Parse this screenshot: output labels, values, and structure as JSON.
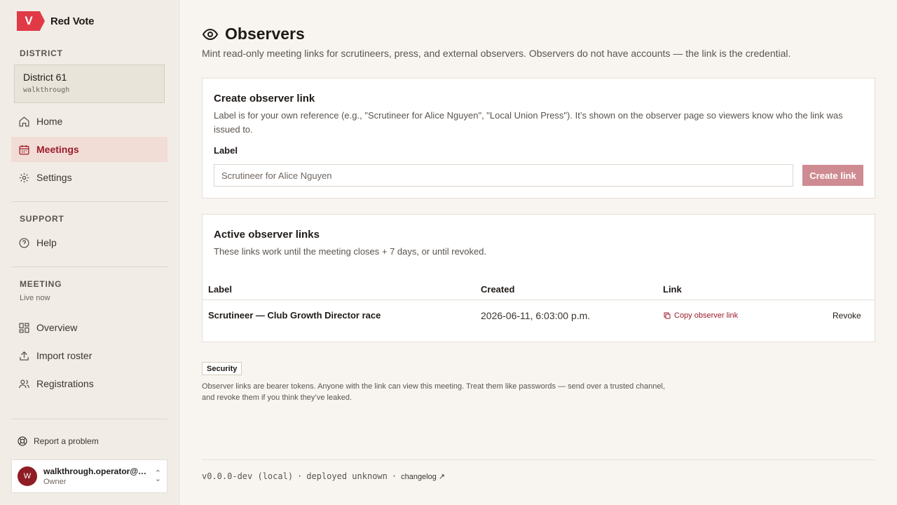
{
  "brand": {
    "logo_letter": "V",
    "name": "Red Vote"
  },
  "sidebar": {
    "district_section": "DISTRICT",
    "district": {
      "name": "District 61",
      "subtitle": "walkthrough"
    },
    "main_nav": [
      {
        "label": "Home",
        "icon": "home-icon"
      },
      {
        "label": "Meetings",
        "icon": "calendar-icon",
        "active": true
      },
      {
        "label": "Settings",
        "icon": "gear-icon"
      }
    ],
    "support_section": "SUPPORT",
    "support_nav": [
      {
        "label": "Help",
        "icon": "help-circle-icon"
      }
    ],
    "meeting_section": "MEETING",
    "meeting_status": "Live now",
    "meeting_nav": [
      {
        "label": "Overview",
        "icon": "grid-icon"
      },
      {
        "label": "Import roster",
        "icon": "upload-icon"
      },
      {
        "label": "Registrations",
        "icon": "users-icon"
      }
    ],
    "report_problem": "Report a problem",
    "user": {
      "initial": "W",
      "email": "walkthrough.operator@ta...",
      "role": "Owner"
    }
  },
  "page": {
    "title": "Observers",
    "description": "Mint read-only meeting links for scrutineers, press, and external observers. Observers do not have accounts — the link is the credential."
  },
  "create_card": {
    "title": "Create observer link",
    "description": "Label is for your own reference (e.g., \"Scrutineer for Alice Nguyen\", \"Local Union Press\"). It’s shown on the observer page so viewers know who the link was issued to.",
    "field_label": "Label",
    "input_placeholder": "Scrutineer for Alice Nguyen",
    "button_label": "Create link"
  },
  "active_card": {
    "title": "Active observer links",
    "description": "These links work until the meeting closes + 7 days, or until revoked.",
    "columns": {
      "label": "Label",
      "created": "Created",
      "link": "Link"
    },
    "rows": [
      {
        "label": "Scrutineer — Club Growth Director race",
        "created": "2026-06-11, 6:03:00 p.m.",
        "copy_label": "Copy observer link",
        "revoke_label": "Revoke"
      }
    ]
  },
  "security": {
    "badge": "Security",
    "text": "Observer links are bearer tokens. Anyone with the link can view this meeting. Treat them like passwords — send over a trusted channel, and revoke them if you think they’ve leaked."
  },
  "footer": {
    "version": "v0.0.0-dev (local)",
    "separator": "·",
    "deployed": "deployed unknown",
    "changelog": "changelog ↗"
  },
  "colors": {
    "accent": "#e03a47",
    "active_bg": "#f2dcd6",
    "active_text": "#9b1c2a",
    "button_disabled": "#cf8b92"
  }
}
